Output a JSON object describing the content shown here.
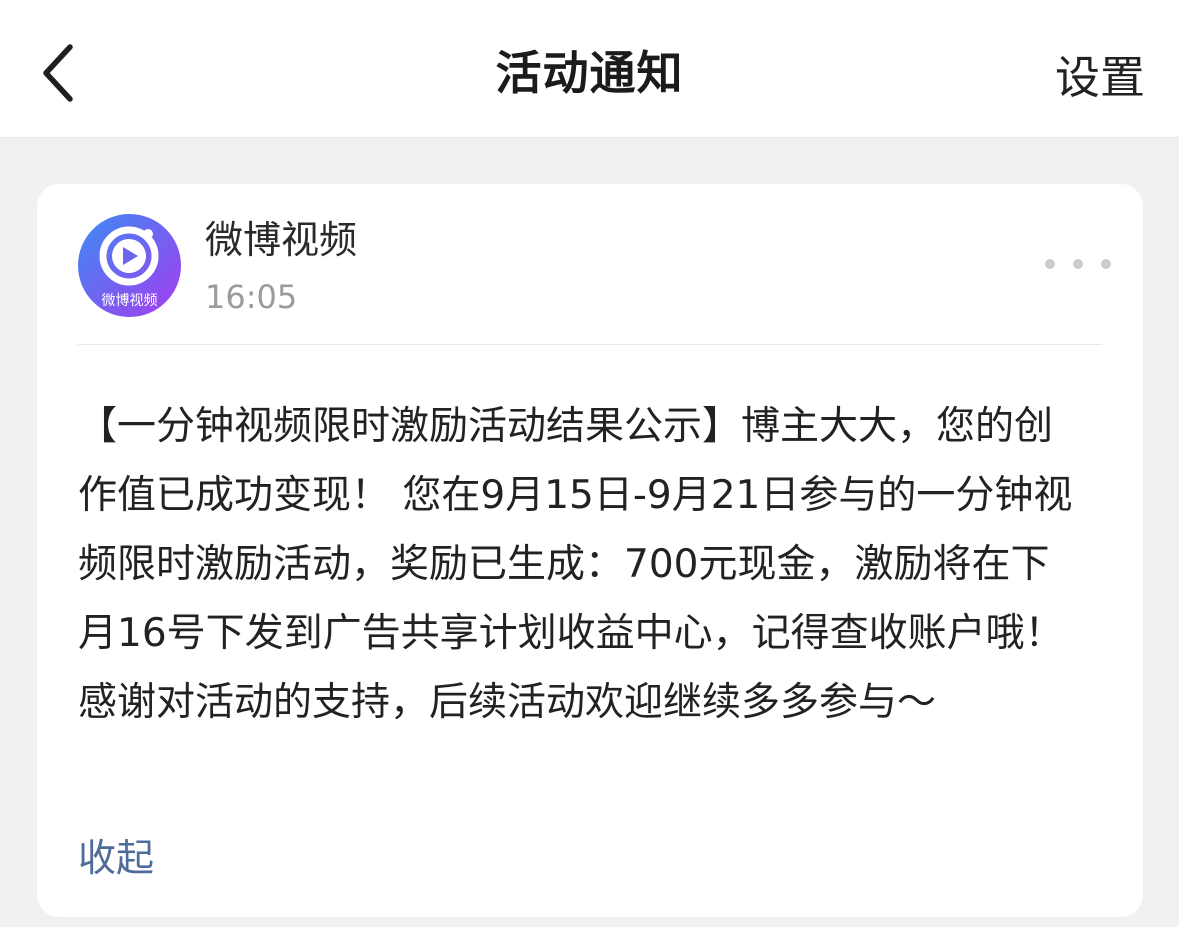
{
  "nav": {
    "title": "活动通知",
    "settings_label": "设置"
  },
  "message": {
    "sender": "微博视频",
    "time": "16:05",
    "avatar_label": "微博视频",
    "body": "【一分钟视频限时激励活动结果公示】博主大大，您的创作值已成功变现！ 您在9月15日-9月21日参与的一分钟视频限时激励活动，奖励已生成：700元现金，激励将在下月16号下发到广告共享计划收益中心，记得查收账户哦！感谢对活动的支持，后续活动欢迎继续多多参与～",
    "collapse_label": "收起"
  },
  "icons": {
    "back": "chevron-left-icon",
    "more": "more-dots-icon",
    "avatar_play": "play-icon"
  },
  "colors": {
    "link": "#4f6b99",
    "avatar_gradient_start": "#3b8cf0",
    "avatar_gradient_end": "#a23ff0"
  }
}
